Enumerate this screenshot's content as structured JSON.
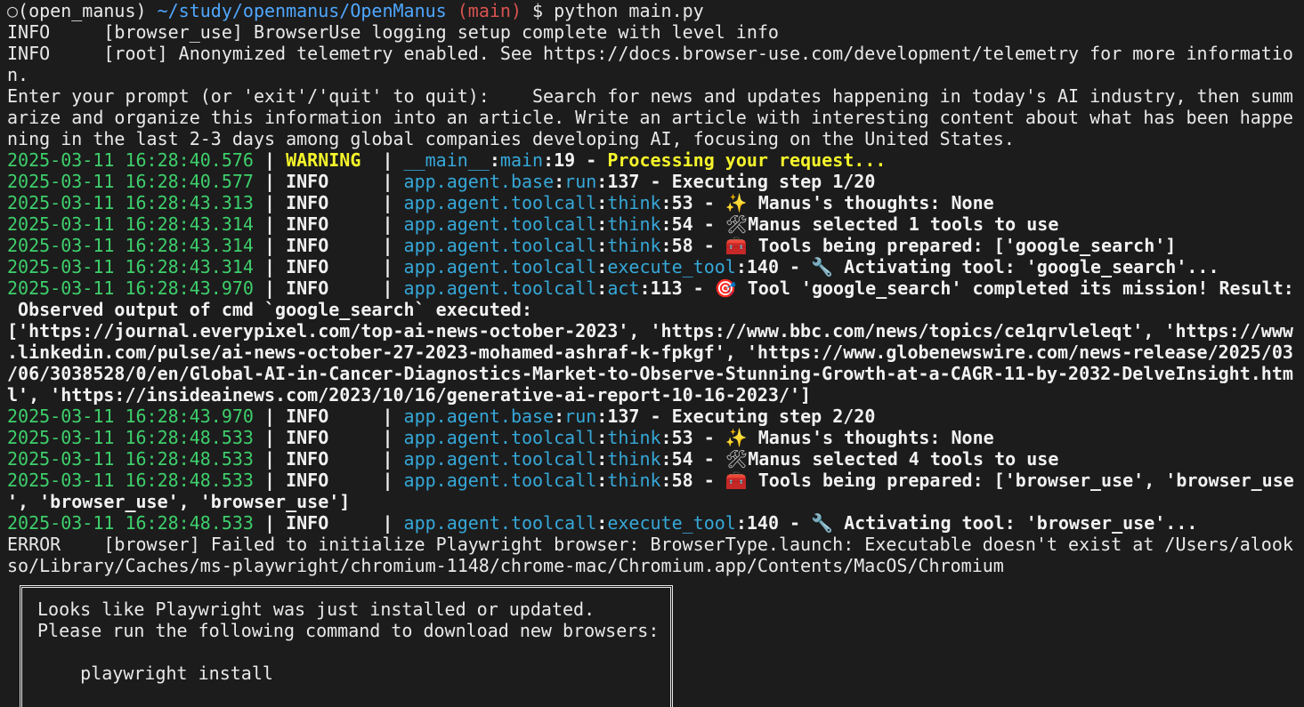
{
  "prompt_line": {
    "dot": "○",
    "env": "(open_manus)",
    "path": "~/study/openmanus/OpenManus",
    "branch": "(main)",
    "command": "$ python main.py"
  },
  "pre_lines": [
    "INFO     [browser_use] BrowserUse logging setup complete with level info",
    "INFO     [root] Anonymized telemetry enabled. See https://docs.browser-use.com/development/telemetry for more informatio",
    "n.",
    "Enter your prompt (or 'exit'/'quit' to quit):    Search for news and updates happening in today's AI industry, then summ",
    "arize and organize this information into an article. Write an article with interesting content about what has been happe",
    "ning in the last 2-3 days among global companies developing AI, focusing on the United States."
  ],
  "log1": {
    "ts": "2025-03-11 16:28:40.576",
    "sep1": " | ",
    "level": "WARNING ",
    "sep2": " | ",
    "mod": "__main__",
    "colon1": ":",
    "func": "main",
    "line": ":19",
    "dash": " - ",
    "msg": "Processing your request..."
  },
  "log2": {
    "ts": "2025-03-11 16:28:40.577",
    "level": "INFO    ",
    "mod": "app.agent.base",
    "func": "run",
    "line": ":137",
    "msg": "Executing step 1/20"
  },
  "log3": {
    "ts": "2025-03-11 16:28:43.313",
    "level": "INFO    ",
    "mod": "app.agent.toolcall",
    "func": "think",
    "line": ":53",
    "emoji": "✨",
    "msg": " Manus's thoughts: None"
  },
  "log4": {
    "ts": "2025-03-11 16:28:43.314",
    "level": "INFO    ",
    "mod": "app.agent.toolcall",
    "func": "think",
    "line": ":54",
    "emoji": "🛠",
    "msg": "Manus selected 1 tools to use"
  },
  "log5": {
    "ts": "2025-03-11 16:28:43.314",
    "level": "INFO    ",
    "mod": "app.agent.toolcall",
    "func": "think",
    "line": ":58",
    "emoji": "🧰",
    "msg": " Tools being prepared: ['google_search']"
  },
  "log6": {
    "ts": "2025-03-11 16:28:43.314",
    "level": "INFO    ",
    "mod": "app.agent.toolcall",
    "func": "execute_tool",
    "line": ":140",
    "emoji": "🔧",
    "msg": " Activating tool: 'google_search'..."
  },
  "log7": {
    "ts": "2025-03-11 16:28:43.970",
    "level": "INFO    ",
    "mod": "app.agent.toolcall",
    "func": "act",
    "line": ":113",
    "emoji": "🎯",
    "msg": " Tool 'google_search' completed its mission! Result:"
  },
  "result_lines": [
    " Observed output of cmd `google_search` executed:",
    "['https://journal.everypixel.com/top-ai-news-october-2023', 'https://www.bbc.com/news/topics/ce1qrvleleqt', 'https://www",
    ".linkedin.com/pulse/ai-news-october-27-2023-mohamed-ashraf-k-fpkgf', 'https://www.globenewswire.com/news-release/2025/03",
    "/06/3038528/0/en/Global-AI-in-Cancer-Diagnostics-Market-to-Observe-Stunning-Growth-at-a-CAGR-11-by-2032-DelveInsight.htm",
    "l', 'https://insideainews.com/2023/10/16/generative-ai-report-10-16-2023/']"
  ],
  "log8": {
    "ts": "2025-03-11 16:28:43.970",
    "level": "INFO    ",
    "mod": "app.agent.base",
    "func": "run",
    "line": ":137",
    "msg": "Executing step 2/20"
  },
  "log9": {
    "ts": "2025-03-11 16:28:48.533",
    "level": "INFO    ",
    "mod": "app.agent.toolcall",
    "func": "think",
    "line": ":53",
    "emoji": "✨",
    "msg": " Manus's thoughts: None"
  },
  "log10": {
    "ts": "2025-03-11 16:28:48.533",
    "level": "INFO    ",
    "mod": "app.agent.toolcall",
    "func": "think",
    "line": ":54",
    "emoji": "🛠",
    "msg": "Manus selected 4 tools to use"
  },
  "log11": {
    "ts": "2025-03-11 16:28:48.533",
    "level": "INFO    ",
    "mod": "app.agent.toolcall",
    "func": "think",
    "line": ":58",
    "emoji": "🧰",
    "msg": " Tools being prepared: ['browser_use', 'browser_use",
    "cont": "', 'browser_use', 'browser_use']"
  },
  "log12": {
    "ts": "2025-03-11 16:28:48.533",
    "level": "INFO    ",
    "mod": "app.agent.toolcall",
    "func": "execute_tool",
    "line": ":140",
    "emoji": "🔧",
    "msg": " Activating tool: 'browser_use'..."
  },
  "error_lines": [
    "ERROR    [browser] Failed to initialize Playwright browser: BrowserType.launch: Executable doesn't exist at /Users/alook",
    "so/Library/Caches/ms-playwright/chromium-1148/chrome-mac/Chromium.app/Contents/MacOS/Chromium"
  ],
  "box_lines": [
    "Looks like Playwright was just installed or updated.",
    "Please run the following command to download new browsers:",
    "",
    "    playwright install"
  ],
  "colors": {
    "background": "#1c1c1c",
    "timestamp": "#3ecf6b",
    "module": "#36a8d8",
    "warning": "#f5f52b",
    "path": "#4fa7ff",
    "branch": "#d9534f"
  }
}
